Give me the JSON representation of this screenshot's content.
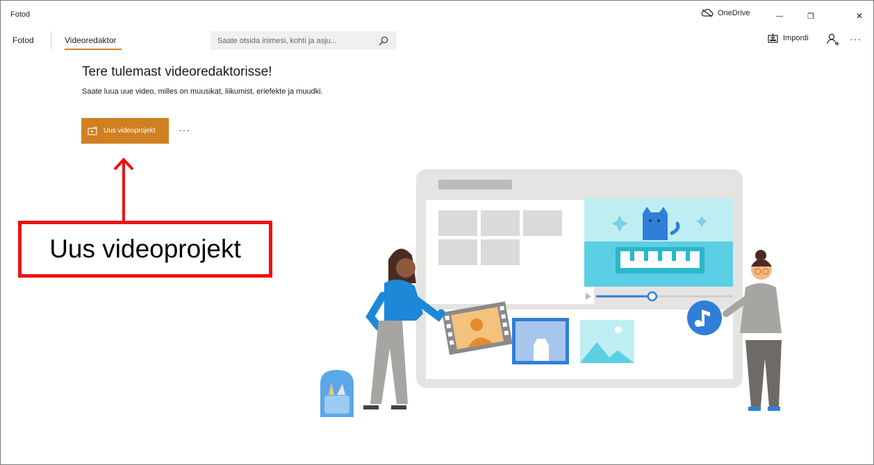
{
  "window": {
    "title": "Fotod",
    "onedrive_label": "OneDrive",
    "minimize_glyph": "—",
    "restore_glyph": "❐",
    "close_glyph": "✕"
  },
  "nav": {
    "tab_photos": "Fotod",
    "tab_video_editor": "Videoredaktor",
    "search_placeholder": "Saate otsida inimesi, kohti ja asju...",
    "import_label": "Impordi",
    "more_glyph": "···"
  },
  "welcome": {
    "title": "Tere tulemast videoredaktorisse!",
    "subtitle": "Saate luua uue video, milles on muusikat, liikumist, eriefekte ja muudki.",
    "new_project_label": "Uus videoprojekt",
    "more_glyph": "···"
  },
  "annotation": {
    "callout_text": "Uus videoprojekt",
    "color": "#ee1111"
  },
  "colors": {
    "accent": "#d08020"
  },
  "icons": {
    "onedrive": "cloud-off-icon",
    "search": "search-icon",
    "import": "import-icon",
    "person": "add-person-icon",
    "new_project": "video-project-icon"
  },
  "illustration": {
    "progress": 0.41
  }
}
